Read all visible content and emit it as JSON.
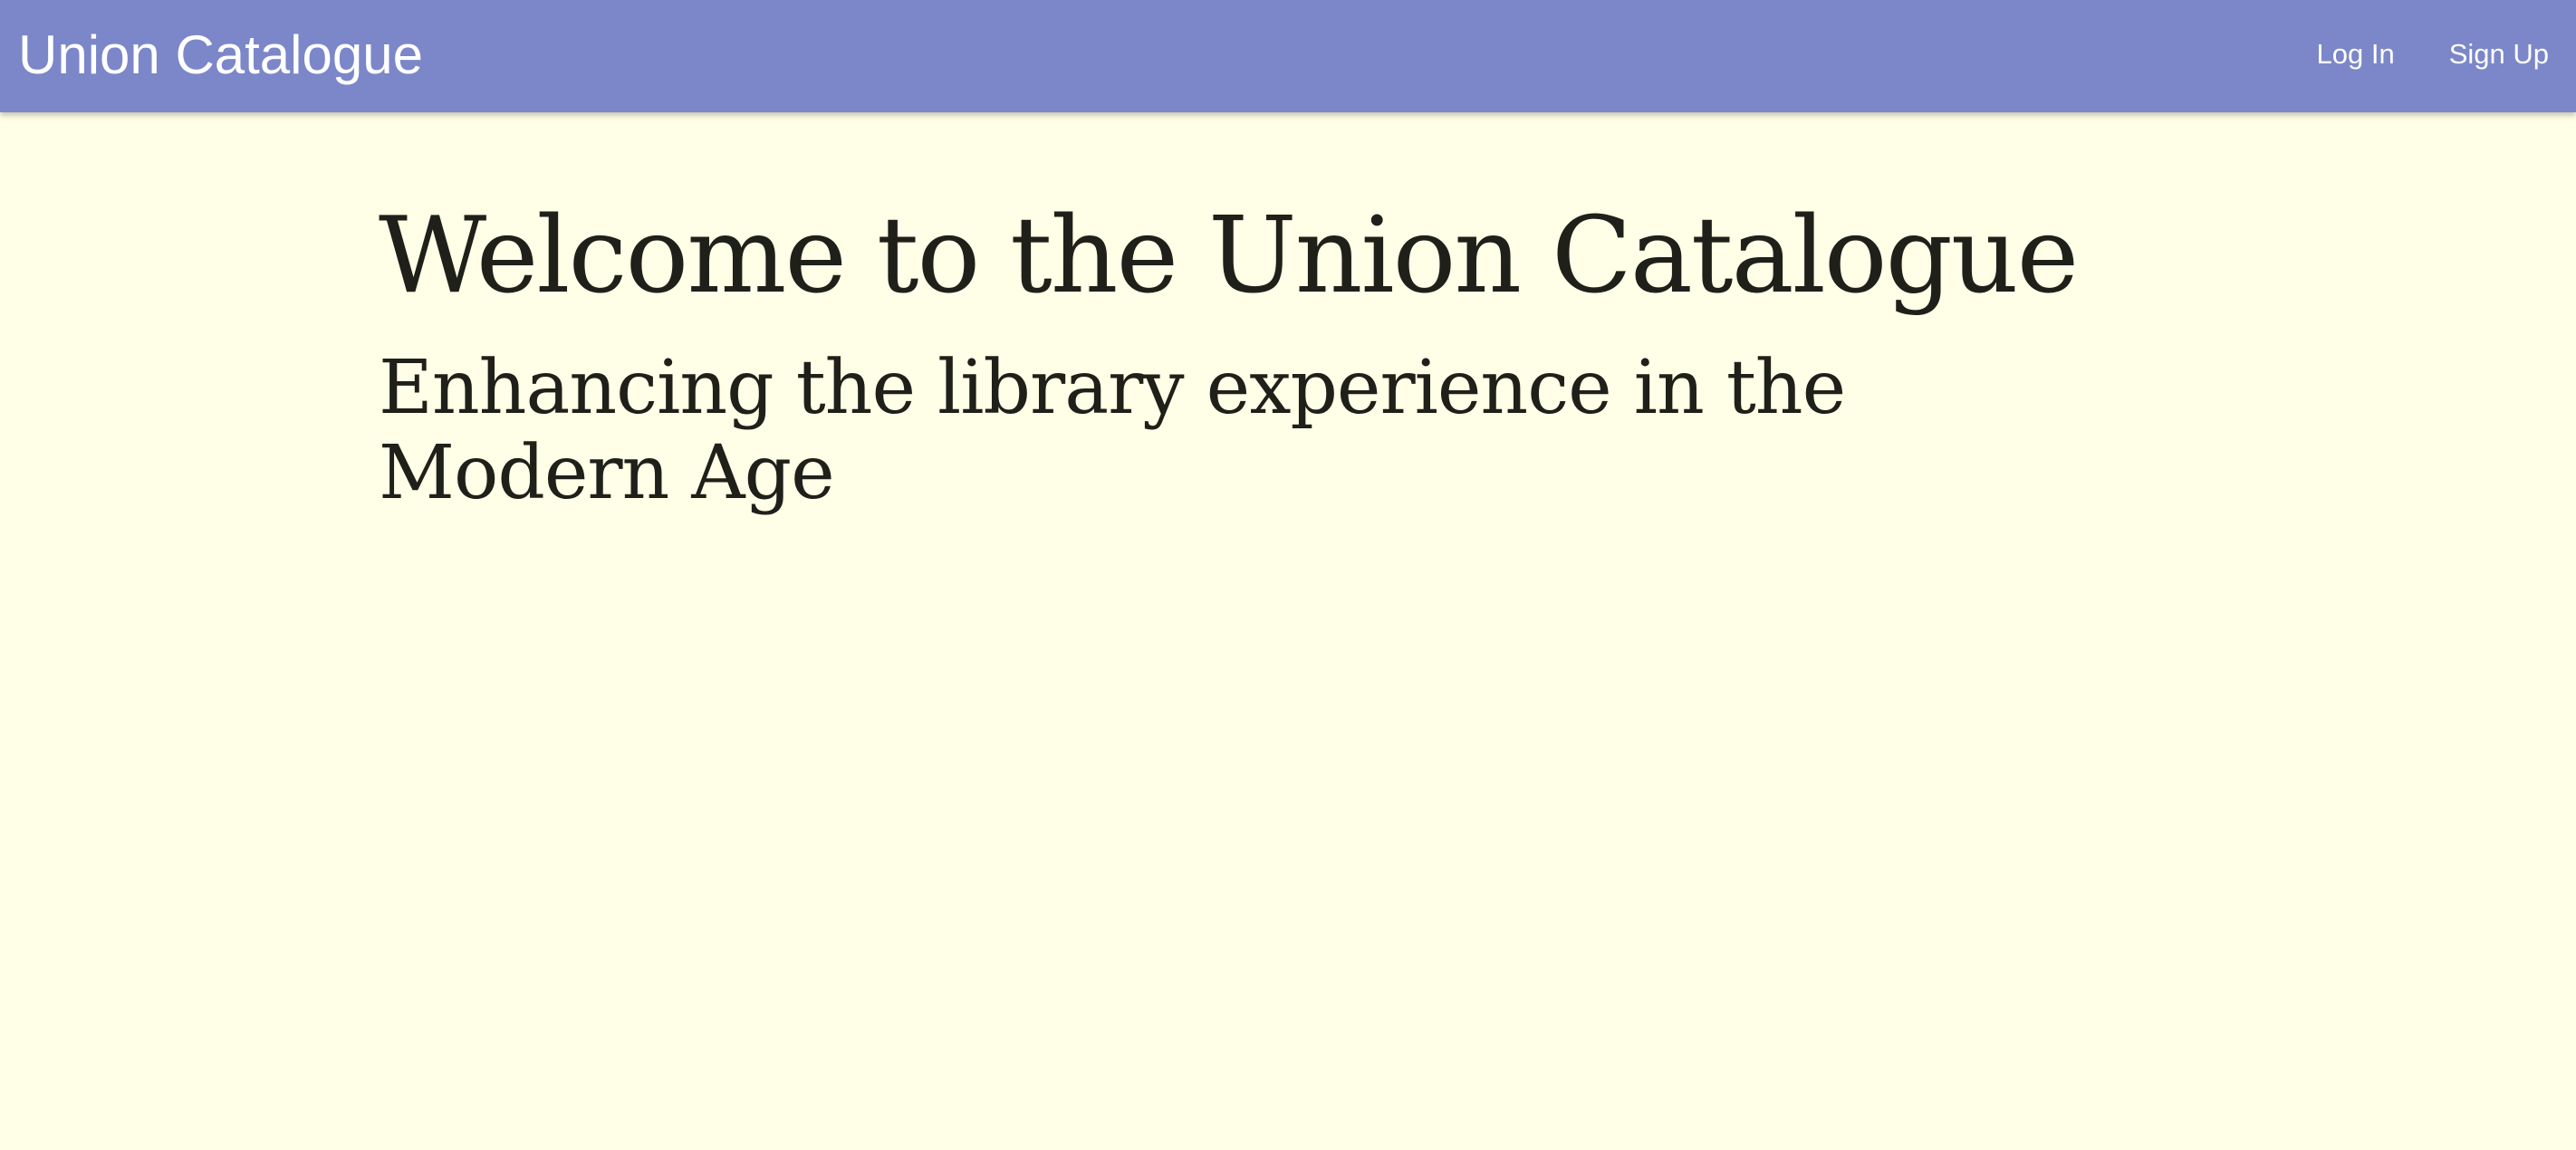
{
  "navbar": {
    "brand": "Union Catalogue",
    "links": [
      {
        "label": "Log In"
      },
      {
        "label": "Sign Up"
      }
    ]
  },
  "main": {
    "title": "Welcome to the Union Catalogue",
    "subtitle": "Enhancing the library experience in the Modern Age"
  },
  "colors": {
    "navbar_bg": "#7B87C8",
    "page_bg": "#FFFFE7",
    "text": "#20201A",
    "nav_text": "#FFFFFF"
  }
}
